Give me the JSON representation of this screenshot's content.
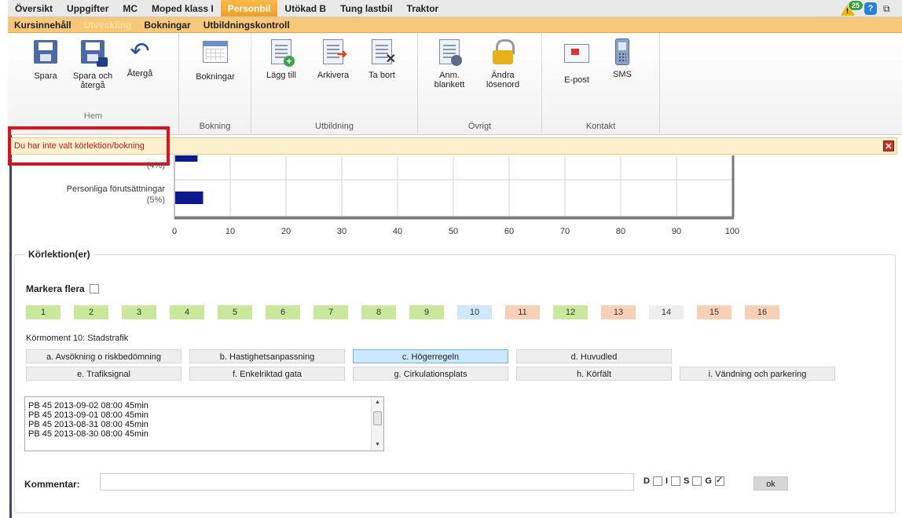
{
  "topnav": {
    "tabs": [
      "Översikt",
      "Uppgifter",
      "MC",
      "Moped klass I",
      "Personbil",
      "Utökad B",
      "Tung lastbil",
      "Traktor"
    ],
    "active_index": 4,
    "notification_count": "25"
  },
  "subnav": {
    "tabs": [
      "Kursinnehåll",
      "Utveckling",
      "Bokningar",
      "Utbildningskontroll"
    ],
    "active_index": 1
  },
  "toolbar": {
    "groups": {
      "hem": "Hem",
      "bokning": "Bokning",
      "utbildning": "Utbildning",
      "ovrigt": "Övrigt",
      "kontakt": "Kontakt"
    },
    "buttons": {
      "spara": "Spara",
      "spara_och_atergå_1": "Spara och",
      "spara_och_atergå_2": "återgå",
      "atergå": "Återgå",
      "bokningar": "Bokningar",
      "lagg_till": "Lägg till",
      "arkivera": "Arkivera",
      "ta_bort": "Ta bort",
      "anm_1": "Anm.",
      "anm_2": "blankett",
      "andra_1": "Ändra",
      "andra_2": "lösenord",
      "epost": "E-post",
      "sms": "SMS"
    }
  },
  "alert": {
    "message": "Du har inte valt körlektion/bokning"
  },
  "chart_data": {
    "type": "bar",
    "orientation": "horizontal",
    "categories": [
      "",
      "Personliga förutsättningar"
    ],
    "category_percent_labels": [
      "(4%)",
      "(5%)"
    ],
    "values": [
      4,
      5
    ],
    "xlim": [
      0,
      100
    ],
    "xticks": [
      "0",
      "10",
      "20",
      "30",
      "40",
      "50",
      "60",
      "70",
      "80",
      "90",
      "100"
    ],
    "grid": true,
    "bar_color": "#0a1a8a"
  },
  "panel": {
    "legend": "Körlektion(er)",
    "mark_multiple": "Markera flera",
    "lessons": [
      {
        "label": "1",
        "status": "green"
      },
      {
        "label": "2",
        "status": "green"
      },
      {
        "label": "3",
        "status": "green"
      },
      {
        "label": "4",
        "status": "green"
      },
      {
        "label": "5",
        "status": "green"
      },
      {
        "label": "6",
        "status": "green"
      },
      {
        "label": "7",
        "status": "green"
      },
      {
        "label": "8",
        "status": "green"
      },
      {
        "label": "9",
        "status": "green"
      },
      {
        "label": "10",
        "status": "blue"
      },
      {
        "label": "11",
        "status": "peach"
      },
      {
        "label": "12",
        "status": "green"
      },
      {
        "label": "13",
        "status": "peach"
      },
      {
        "label": "14",
        "status": "grey"
      },
      {
        "label": "15",
        "status": "peach"
      },
      {
        "label": "16",
        "status": "peach"
      }
    ],
    "moment_label": "Körmoment 10: Stadstrafik",
    "moments": [
      "a. Avsökning o riskbedömning",
      "b. Hastighetsanpassning",
      "c. Högerregeln",
      "d. Huvudled",
      "e. Trafiksignal",
      "f. Enkelriktad gata",
      "g. Cirkulationsplats",
      "h. Körfält",
      "i. Vändning och parkering"
    ],
    "selected_moment": 2,
    "bookings": [
      "PB 45 2013-09-02 08:00 45min",
      "PB 45 2013-09-01 08:00 45min",
      "PB 45 2013-08-31 08:00 45min",
      "PB 45 2013-08-30 08:00 45min"
    ],
    "comment_label": "Kommentar:",
    "comment_value": "",
    "flags": [
      {
        "label": "D",
        "checked": false
      },
      {
        "label": "I",
        "checked": false
      },
      {
        "label": "S",
        "checked": false
      },
      {
        "label": "G",
        "checked": true
      }
    ],
    "ok_label": "ok"
  }
}
